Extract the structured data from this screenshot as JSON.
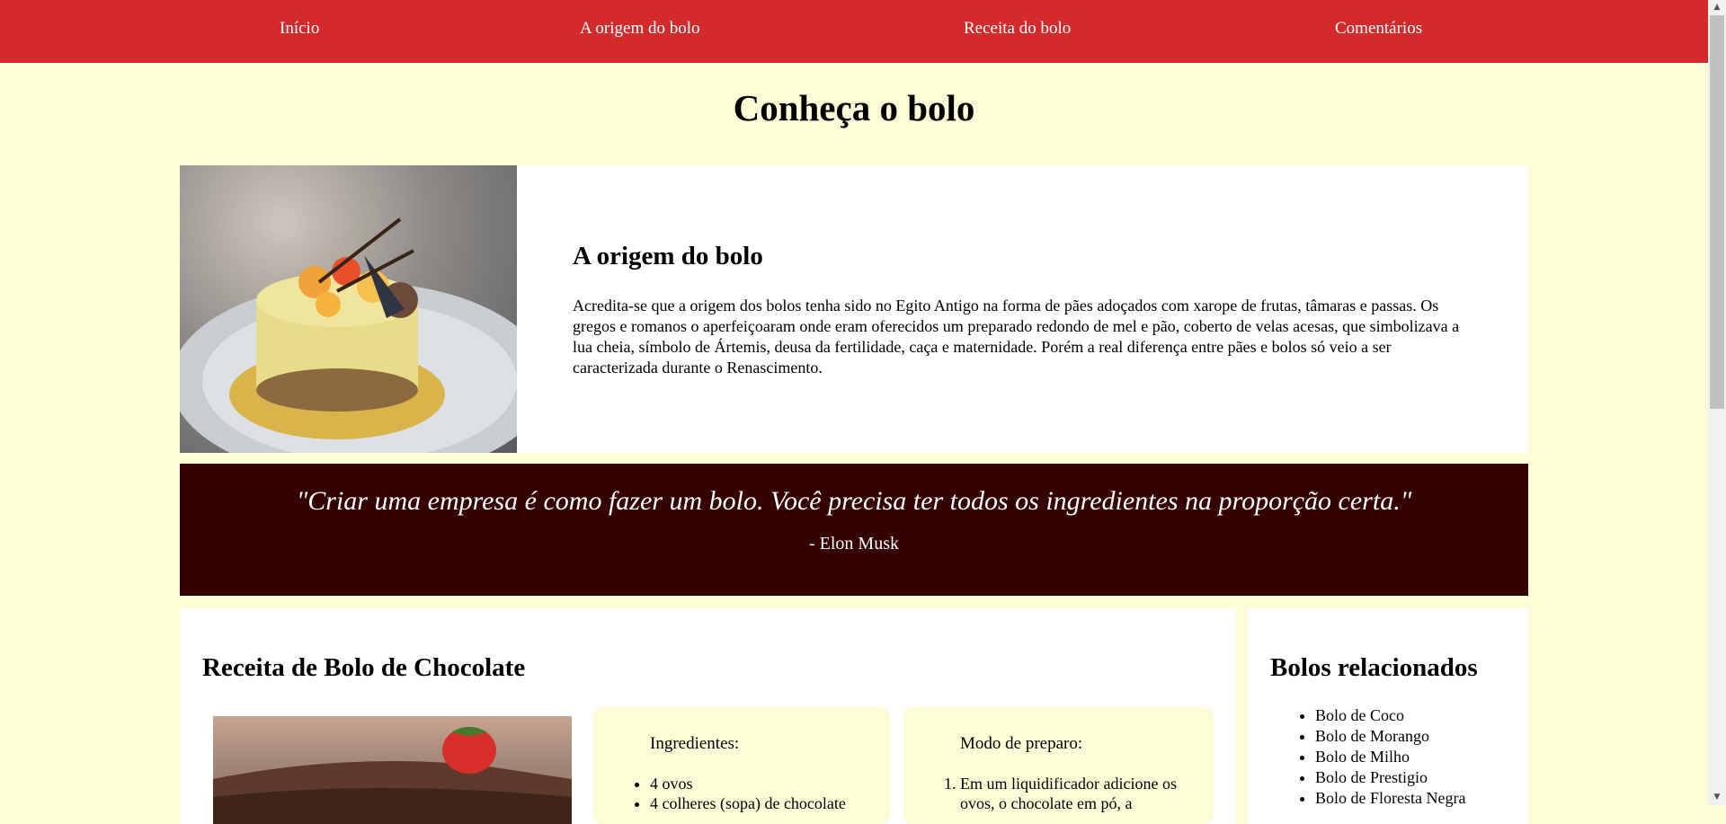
{
  "nav": {
    "items": [
      {
        "label": "Início"
      },
      {
        "label": "A origem do bolo"
      },
      {
        "label": "Receita do bolo"
      },
      {
        "label": "Comentários"
      }
    ],
    "background": "#d32b2c"
  },
  "page": {
    "title": "Conheça o bolo",
    "background": "#fcfdd6"
  },
  "origin": {
    "heading": "A origem do bolo",
    "text": "Acredita-se que a origem dos bolos tenha sido no Egito Antigo na forma de pães adoçados com xarope de frutas, tâmaras e passas. Os gregos e romanos o aperfeiçoaram onde eram oferecidos um preparado redondo de mel e pão, coberto de velas acesas, que simbolizava a lua cheia, símbolo de Ártemis, deusa da fertilidade, caça e maternidade. Porém a real diferença entre pães e bolos só veio a ser caracterizada durante o Renascimento."
  },
  "quote": {
    "text": "\"Criar uma empresa é como fazer um bolo. Você precisa ter todos os ingredientes na proporção certa.\"",
    "author": "- Elon Musk",
    "background": "#350000"
  },
  "recipe": {
    "title": "Receita de Bolo de Chocolate",
    "ingredients_heading": "Ingredientes:",
    "ingredients": [
      "4 ovos",
      "4 colheres (sopa) de chocolate"
    ],
    "preparation_heading": "Modo de preparo:",
    "steps": [
      "Em um liquidificador adicione os ovos, o chocolate em pó, a"
    ]
  },
  "related": {
    "title": "Bolos relacionados",
    "items": [
      "Bolo de Coco",
      "Bolo de Morango",
      "Bolo de Milho",
      "Bolo de Prestigio",
      "Bolo de Floresta Negra"
    ]
  },
  "icons": {
    "scroll_up": "scroll-up-arrow-icon",
    "scroll_down": "scroll-down-arrow-icon"
  }
}
